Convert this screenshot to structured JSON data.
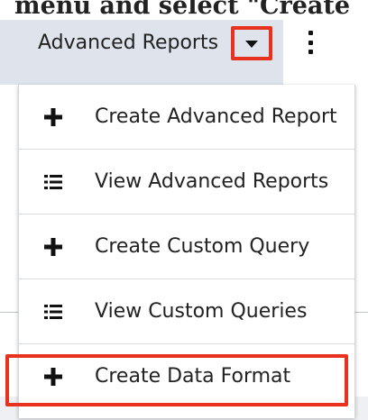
{
  "caption": "menu and select \"Create",
  "header": {
    "module_name": "Advanced Reports",
    "caret_icon": "caret-down-icon",
    "more_icon": "kebab-vertical-icon",
    "highlight_color": "#e8321f"
  },
  "menu": {
    "items": [
      {
        "label": "Create Advanced Report",
        "icon": "plus-icon"
      },
      {
        "label": "View Advanced Reports",
        "icon": "list-icon"
      },
      {
        "label": "Create Custom Query",
        "icon": "plus-icon"
      },
      {
        "label": "View Custom Queries",
        "icon": "list-icon"
      },
      {
        "label": "Create Data Format",
        "icon": "plus-icon",
        "highlighted": true
      }
    ]
  }
}
